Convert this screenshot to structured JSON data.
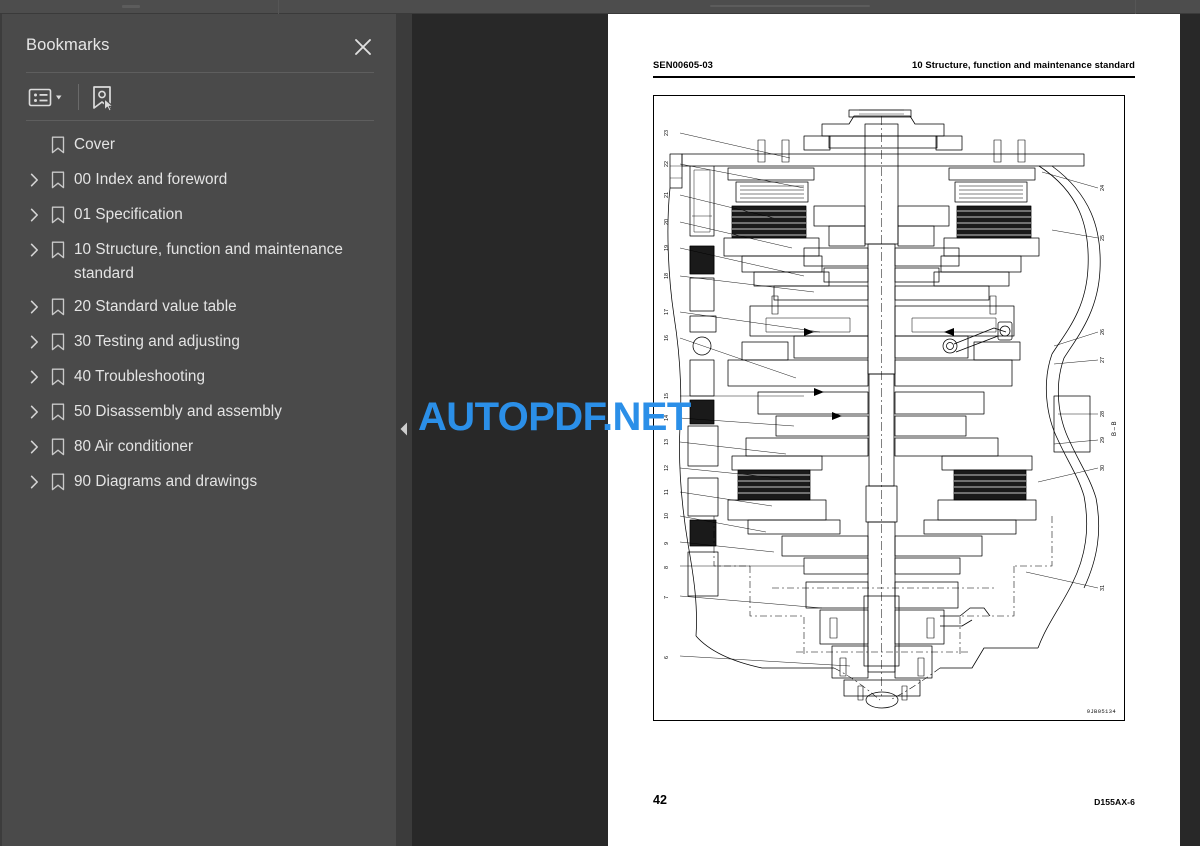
{
  "app": {
    "watermark": "AUTOPDF.NET",
    "watermark_color": "#2b8fe8",
    "sidebar_bg": "#4a4a4a",
    "viewer_bg": "#282828"
  },
  "sidebar": {
    "title": "Bookmarks",
    "close_icon": "close-icon",
    "toolbar": {
      "list_options_icon": "list-options-icon",
      "list_options_caret": "chevron-down-icon",
      "select_bookmark_icon": "bookmark-cursor-icon"
    },
    "items": [
      {
        "label": "Cover",
        "expandable": false
      },
      {
        "label": "00 Index and foreword",
        "expandable": true
      },
      {
        "label": "01 Specification",
        "expandable": true
      },
      {
        "label": "10 Structure, function and maintenance standard",
        "expandable": true
      },
      {
        "label": "20 Standard value table",
        "expandable": true
      },
      {
        "label": "30 Testing and adjusting",
        "expandable": true
      },
      {
        "label": "40 Troubleshooting",
        "expandable": true
      },
      {
        "label": "50 Disassembly and assembly",
        "expandable": true
      },
      {
        "label": "80 Air conditioner",
        "expandable": true
      },
      {
        "label": "90 Diagrams and drawings",
        "expandable": true
      }
    ]
  },
  "viewer": {
    "collapse_handle_icon": "triangle-left-icon"
  },
  "page": {
    "header_left": "SEN00605-03",
    "header_right": "10 Structure, function and maintenance standard",
    "footer_page": "42",
    "footer_model": "D155AX-6",
    "drawing_id": "9JB05134",
    "section_label": "B – B",
    "callouts_left": [
      "23",
      "22",
      "21",
      "20",
      "19",
      "18",
      "17",
      "16",
      "15",
      "14",
      "13",
      "12",
      "11",
      "10",
      "9",
      "8",
      "7",
      "6"
    ],
    "callouts_right": [
      "24",
      "25",
      "26",
      "27",
      "28",
      "29",
      "30",
      "31"
    ]
  }
}
